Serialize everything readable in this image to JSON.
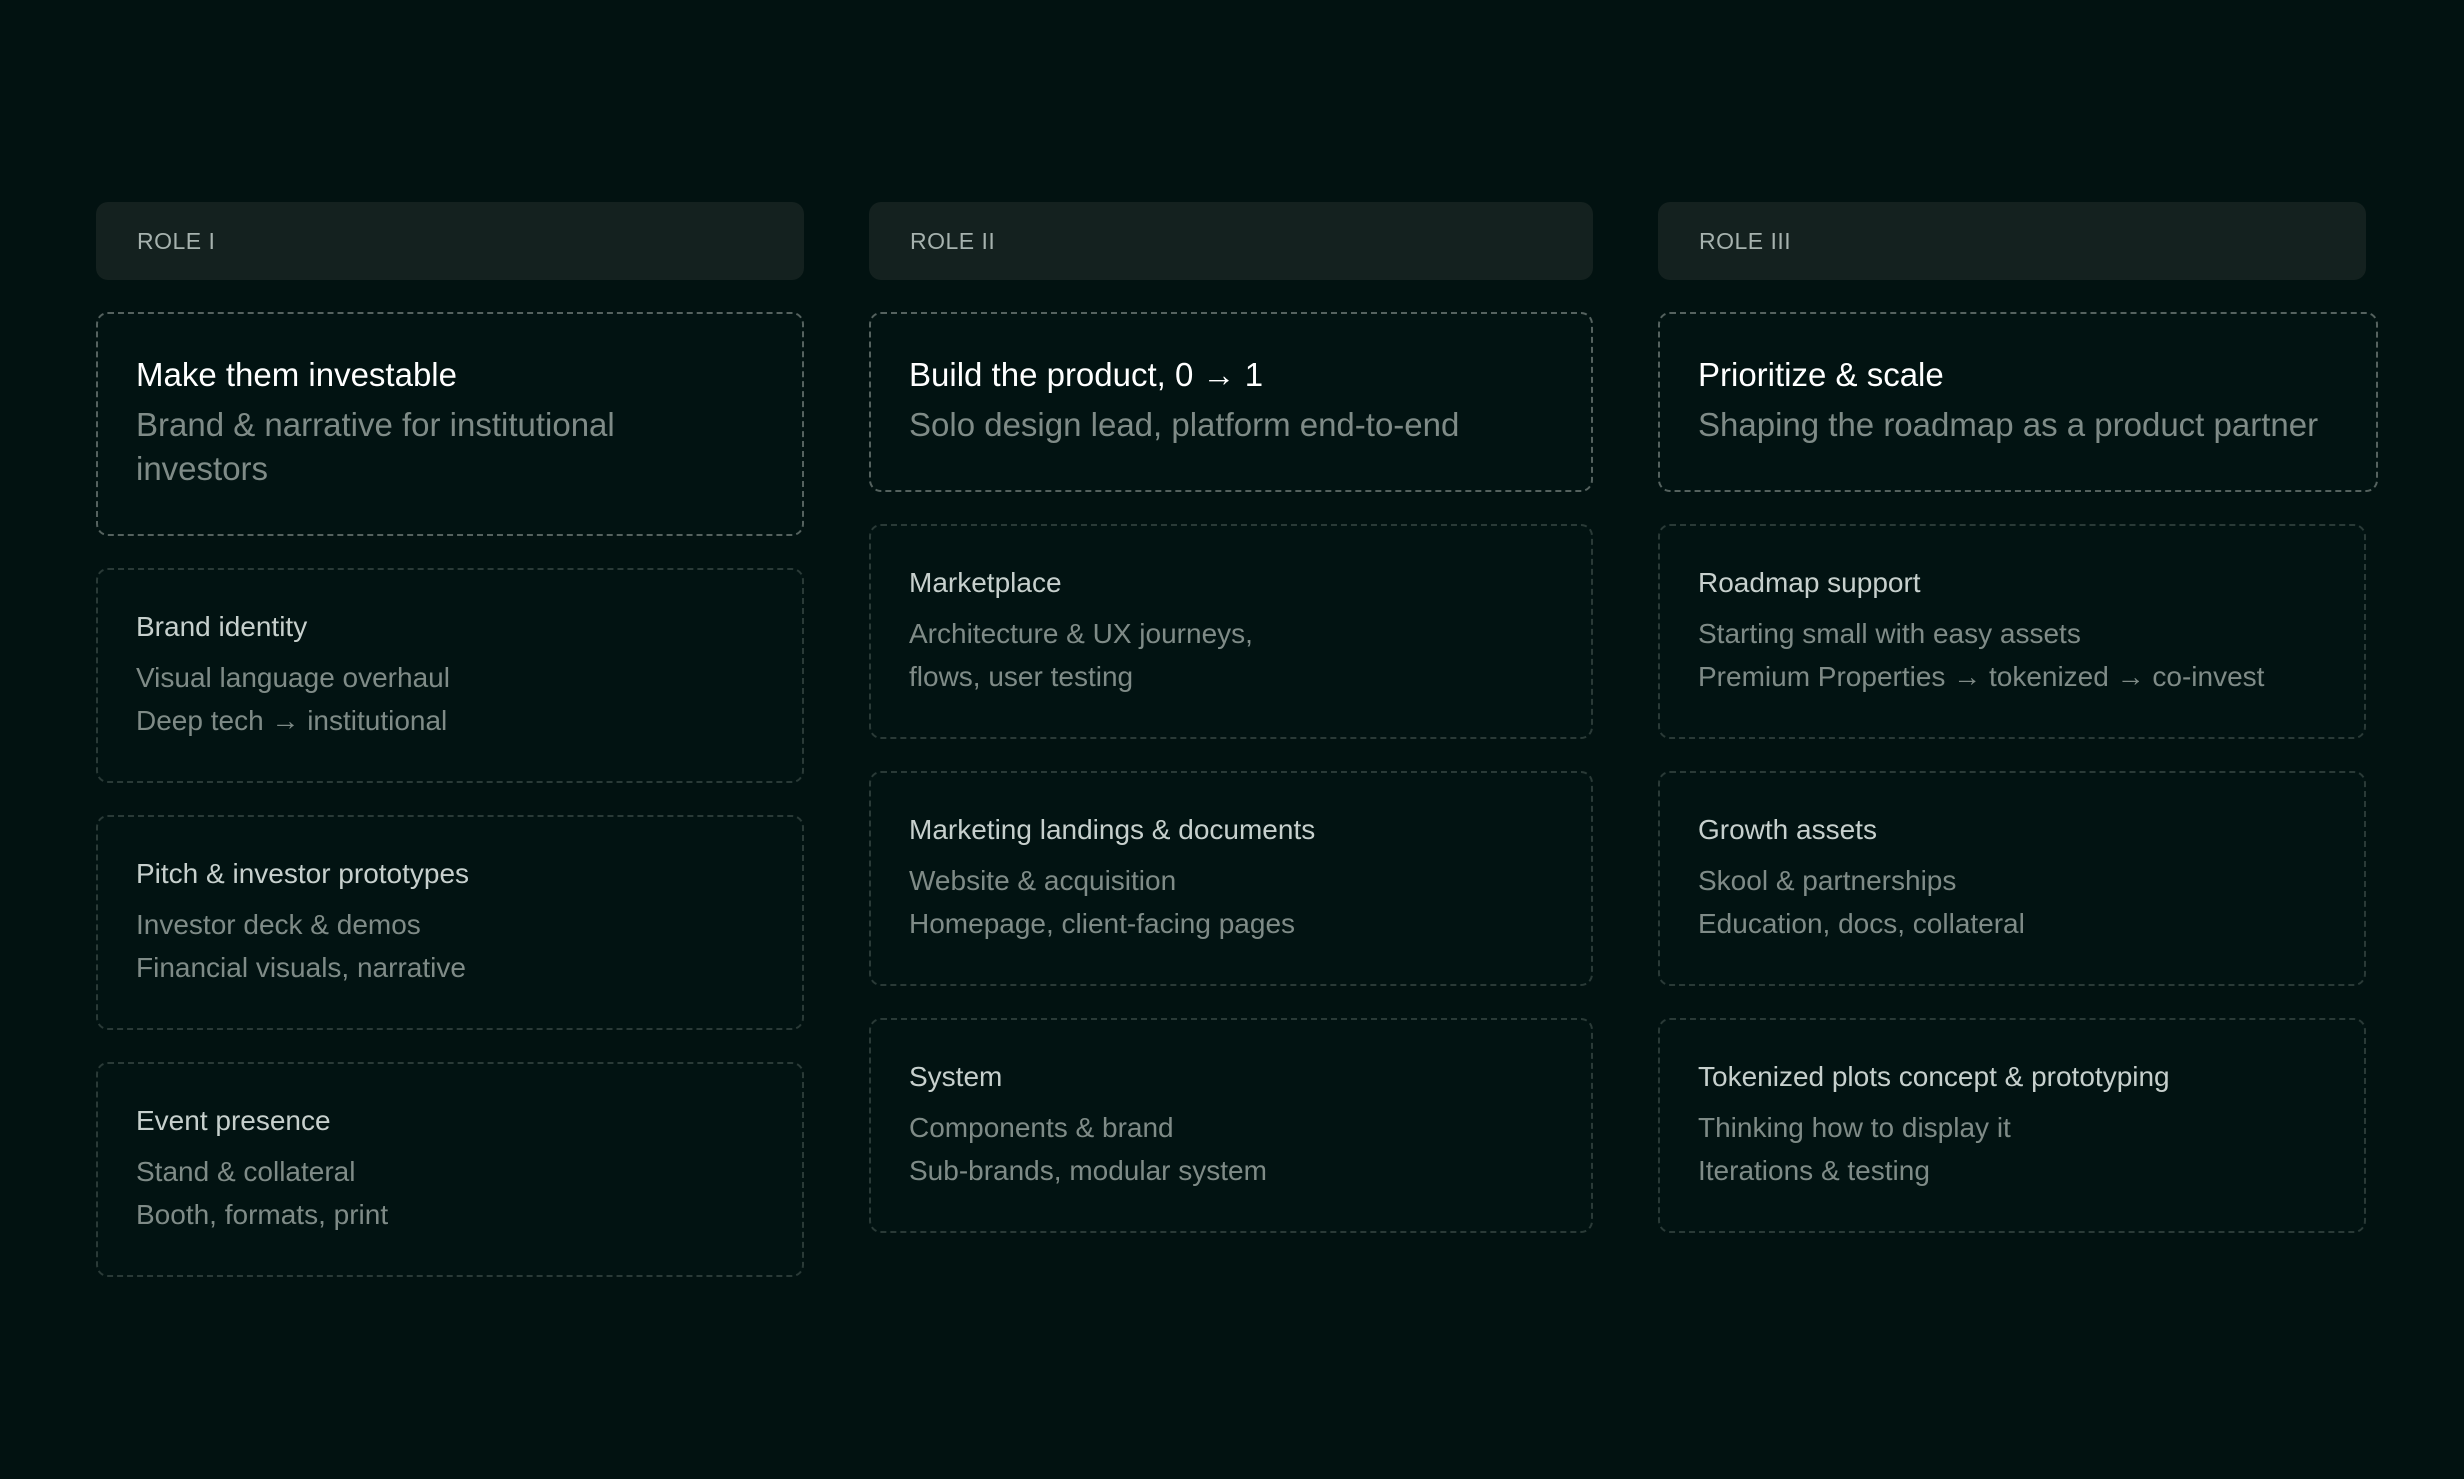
{
  "roles": [
    {
      "label": "ROLE I",
      "title": "Make them investable",
      "subtitle": "Brand & narrative for institutional investors",
      "items": [
        {
          "title": "Brand identity",
          "lines": [
            "Visual language overhaul",
            "Deep tech → institutional"
          ]
        },
        {
          "title": "Pitch & investor prototypes",
          "lines": [
            "Investor deck & demos",
            "Financial visuals, narrative"
          ]
        },
        {
          "title": "Event presence",
          "lines": [
            "Stand & collateral",
            "Booth, formats, print"
          ]
        }
      ]
    },
    {
      "label": "ROLE II",
      "title": "Build the product, 0 → 1",
      "subtitle": "Solo design lead, platform end-to-end",
      "items": [
        {
          "title": "Marketplace",
          "lines": [
            "Architecture & UX journeys,",
            "flows, user testing"
          ]
        },
        {
          "title": "Marketing landings & documents",
          "lines": [
            "Website & acquisition",
            "Homepage, client-facing pages"
          ]
        },
        {
          "title": "System",
          "lines": [
            "Components & brand",
            "Sub-brands, modular system"
          ]
        }
      ]
    },
    {
      "label": "ROLE III",
      "title": "Prioritize & scale",
      "subtitle": "Shaping the roadmap as a product partner",
      "items": [
        {
          "title": "Roadmap support",
          "lines": [
            "Starting small with easy assets",
            "Premium Properties → tokenized → co-invest"
          ]
        },
        {
          "title": "Growth assets",
          "lines": [
            "Skool & partnerships",
            "Education, docs, collateral"
          ]
        },
        {
          "title": "Tokenized plots concept & prototyping",
          "lines": [
            "Thinking how to display it",
            "Iterations & testing"
          ]
        }
      ]
    }
  ]
}
